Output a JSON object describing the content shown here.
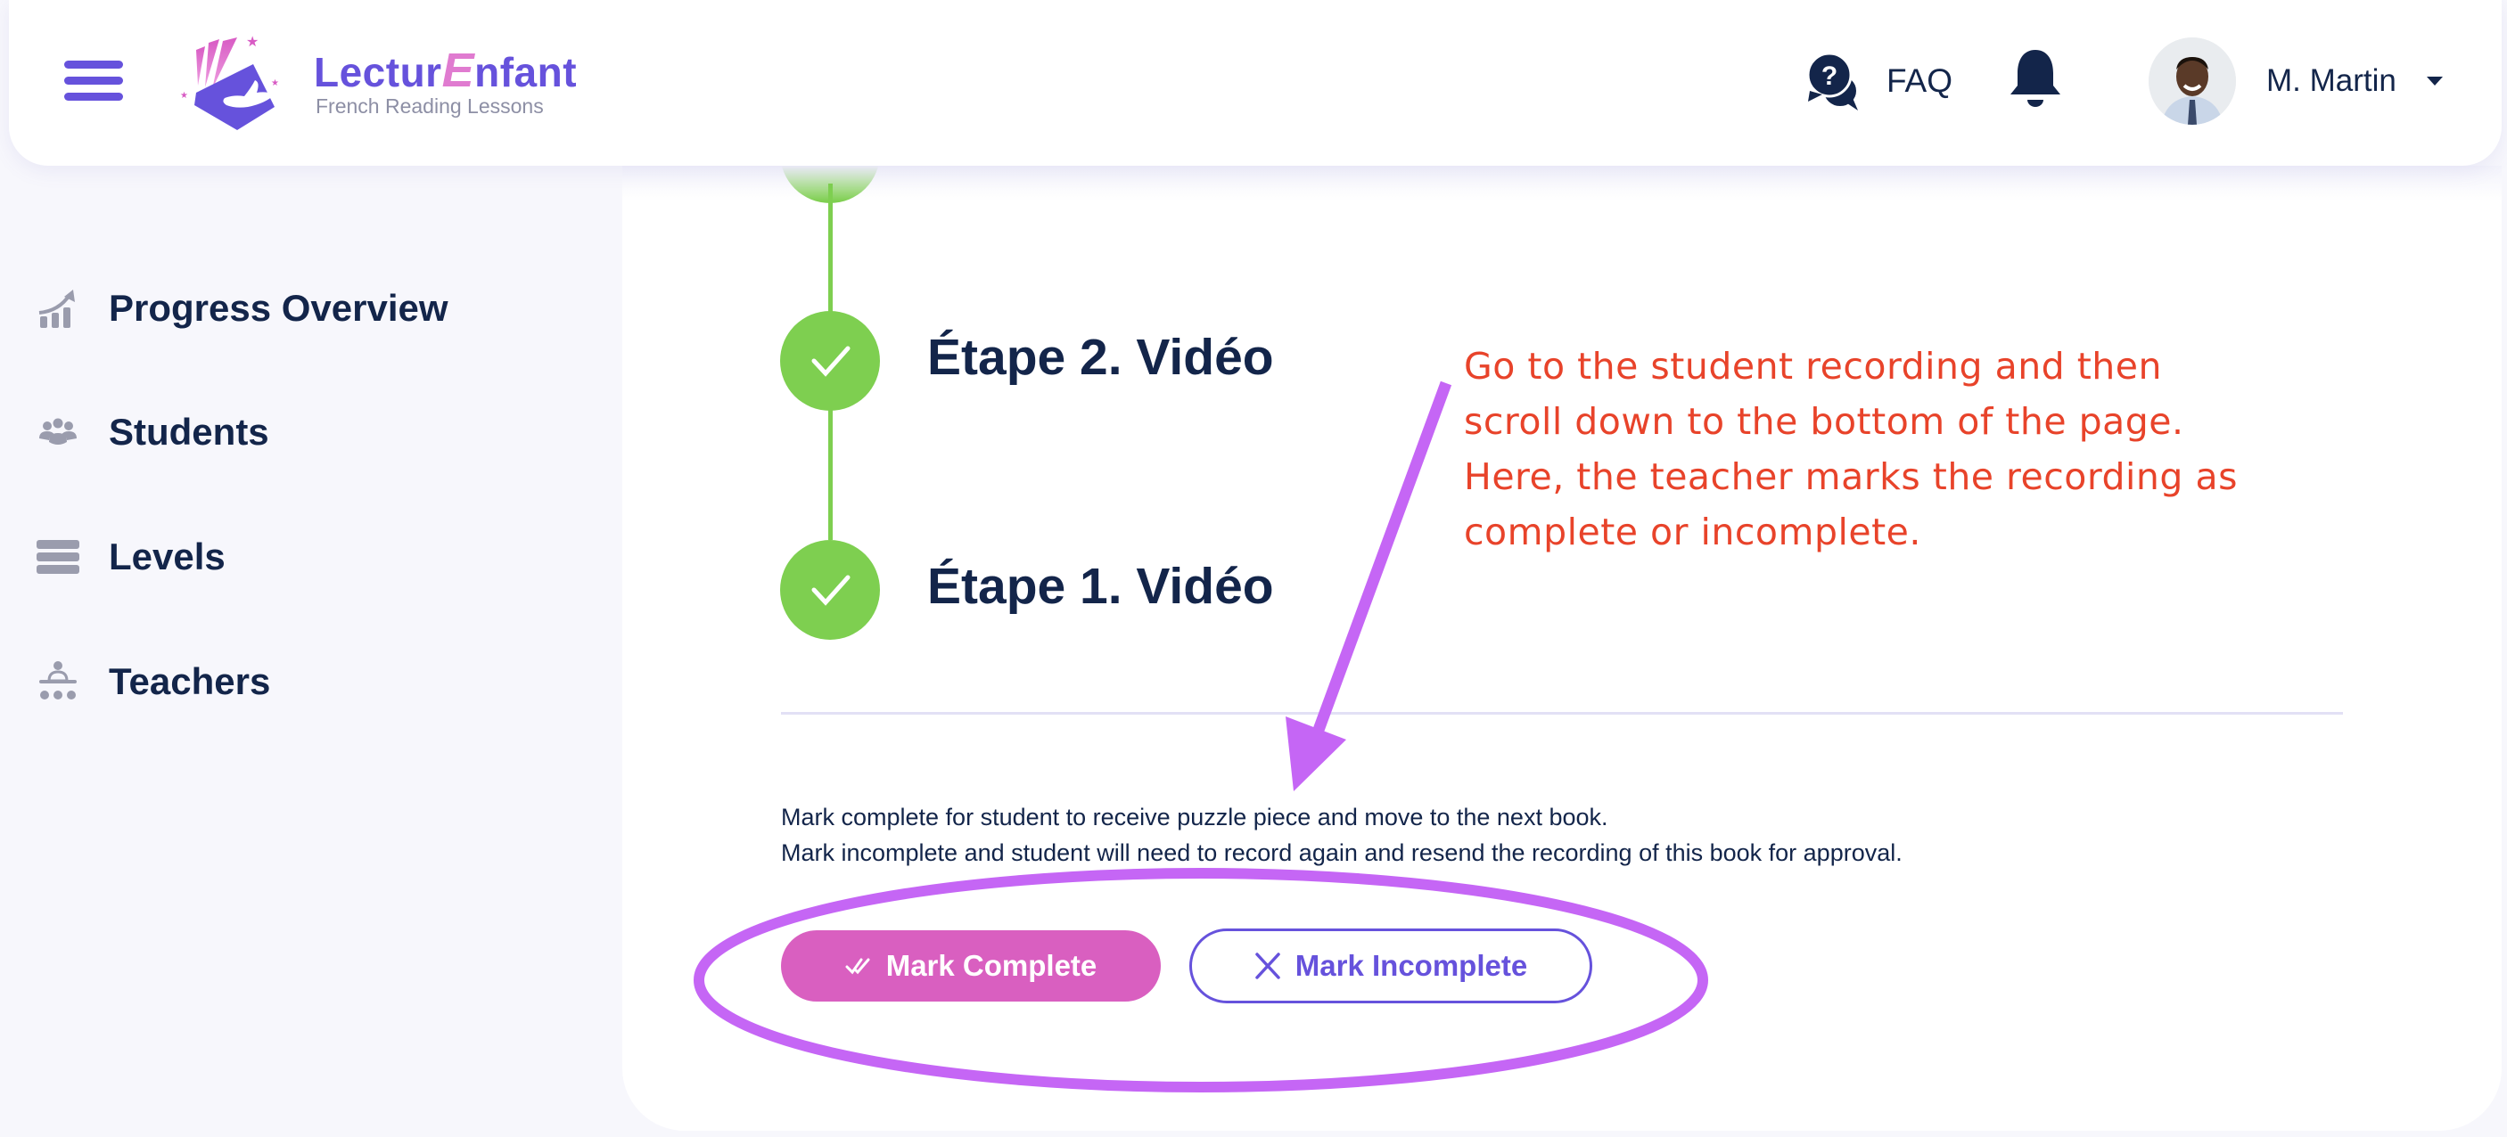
{
  "header": {
    "menu_icon": "hamburger-menu-icon",
    "logo": {
      "title_part1": "Lectur",
      "title_accent": "E",
      "title_part2": "nfant",
      "subtitle": "French Reading Lessons"
    },
    "faq_label": "FAQ",
    "notifications_icon": "bell-icon",
    "user": {
      "name": "M. Martin",
      "avatar": "user-avatar-photo"
    }
  },
  "sidebar": {
    "items": [
      {
        "label": "Progress Overview",
        "icon": "chart-growth-icon"
      },
      {
        "label": "Students",
        "icon": "users-group-icon"
      },
      {
        "label": "Levels",
        "icon": "layers-icon"
      },
      {
        "label": "Teachers",
        "icon": "teacher-classroom-icon"
      }
    ]
  },
  "timeline": {
    "steps": [
      {
        "title": "Étape 2. Vidéo",
        "status": "complete"
      },
      {
        "title": "Étape 1. Vidéo",
        "status": "complete"
      }
    ]
  },
  "review": {
    "line1": "Mark complete for student to receive puzzle piece and move to the next book.",
    "line2": "Mark incomplete and student will need to record again and resend the recording of this book for approval.",
    "complete_label": "Mark Complete",
    "incomplete_label": "Mark Incomplete"
  },
  "annotation": {
    "lines": [
      "Go to the student recording and then",
      "scroll down to the bottom of the page.",
      "Here, the teacher marks the recording as",
      "complete or incomplete."
    ]
  },
  "colors": {
    "brand_purple": "#6652dc",
    "brand_pink": "#d95fc0",
    "success_green": "#7ecf50",
    "text_navy": "#13254a",
    "annotation_red": "#e8432a",
    "annotation_violet": "#c566f5"
  }
}
